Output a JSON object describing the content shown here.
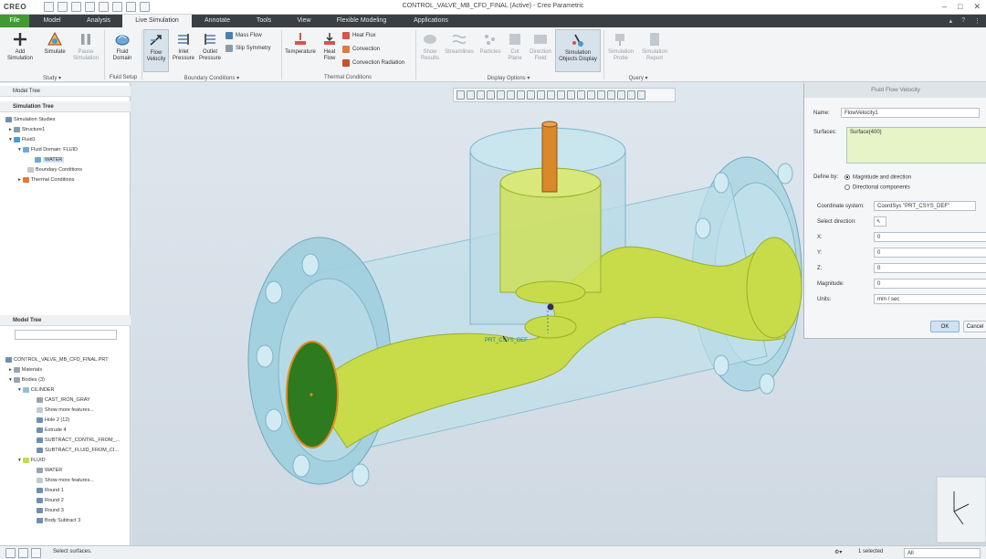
{
  "app": {
    "logo": "CREO",
    "window_title": "CONTROL_VALVE_MB_CFD_FINAL (Active) - Creo Parametric"
  },
  "menu": {
    "tabs": [
      "File",
      "Model",
      "Analysis",
      "Live Simulation",
      "Annotate",
      "Tools",
      "View",
      "Flexible Modeling",
      "Applications"
    ],
    "active": "Live Simulation"
  },
  "ribbon": {
    "buttons": {
      "add_simulation": "Add Simulation",
      "simulate": "Simulate",
      "pause_simulation": "Pause Simulation",
      "fluid_domain": "Fluid Domain",
      "flow_velocity": "Flow Velocity",
      "inlet_pressure": "Inlet Pressure",
      "outlet_pressure": "Outlet Pressure",
      "mass_flow": "Mass Flow",
      "slip_symmetry": "Slip Symmetry",
      "temperature": "Temperature",
      "heat_flow": "Heat Flow",
      "heat_flux": "Heat Flux",
      "convection": "Convection",
      "convection_radiation": "Convection Radiation",
      "show_results": "Show Results",
      "streamlines": "Streamlines",
      "particles": "Particles",
      "cut_plane": "Cut Plane",
      "direction_field": "Direction Field",
      "simulation_objects_display": "Simulation Objects Display",
      "simulation_probe": "Simulation Probe",
      "simulation_report": "Simulation Report"
    },
    "groups": {
      "study": "Study ▾",
      "fluid_setup": "Fluid Setup",
      "boundary_conditions": "Boundary Conditions ▾",
      "thermal_conditions": "Thermal Conditions",
      "display_options": "Display Options ▾",
      "query": "Query ▾"
    }
  },
  "left_panel": {
    "model_tree_tab": "Model Tree",
    "simulation_tree": {
      "header": "Simulation Tree",
      "items": [
        "Simulation Studies",
        "Structure1",
        "Fluid1",
        "Fluid Domain: FLUID",
        "WATER",
        "Boundary Conditions",
        "Thermal Conditions"
      ]
    },
    "model_tree": {
      "header": "Model Tree",
      "items": [
        "CONTROL_VALVE_MB_CFD_FINAL.PRT",
        "Materials",
        "Bodies (3)",
        "CILINDER",
        "CAST_IRON_GRAY",
        "Show more features...",
        "Hole 2 (12)",
        "Extrude 4",
        "SUBTRACT_CONTRL_FROM_...",
        "SUBTRACT_FLUID_FROM_CI...",
        "FLUID",
        "WATER",
        "Show more features...",
        "Round 1",
        "Round 2",
        "Round 3",
        "Body Subtract 3"
      ]
    }
  },
  "viewport": {
    "csys_label": "PRT_CSYS_DEF"
  },
  "dialog": {
    "title": "Fluid Flow Velocity",
    "name_label": "Name:",
    "name_value": "FlowVelocity1",
    "surfaces_label": "Surfaces:",
    "surfaces_value": "Surface(400)",
    "define_by_label": "Define by:",
    "option_magnitude": "Magnitude and direction",
    "option_components": "Directional components",
    "coordinate_system_label": "Coordinate system:",
    "coordinate_system_value": "CoordSys \"PRT_CSYS_DEF\"",
    "select_direction_label": "Select direction:",
    "x_label": "X:",
    "x_value": "0",
    "y_label": "Y:",
    "y_value": "0",
    "z_label": "Z:",
    "z_value": "0",
    "magnitude_label": "Magnitude:",
    "magnitude_value": "0",
    "units_label": "Units:",
    "units_value": "mm / sec",
    "ok": "OK",
    "cancel": "Cancel"
  },
  "status": {
    "message": "Select surfaces.",
    "selected": "1 selected",
    "filter": "All"
  },
  "colors": {
    "file_tab": "#3f9b2f",
    "fluid": "#c8dc4a",
    "housing": "#9fd0e0",
    "stem": "#d9892a"
  }
}
